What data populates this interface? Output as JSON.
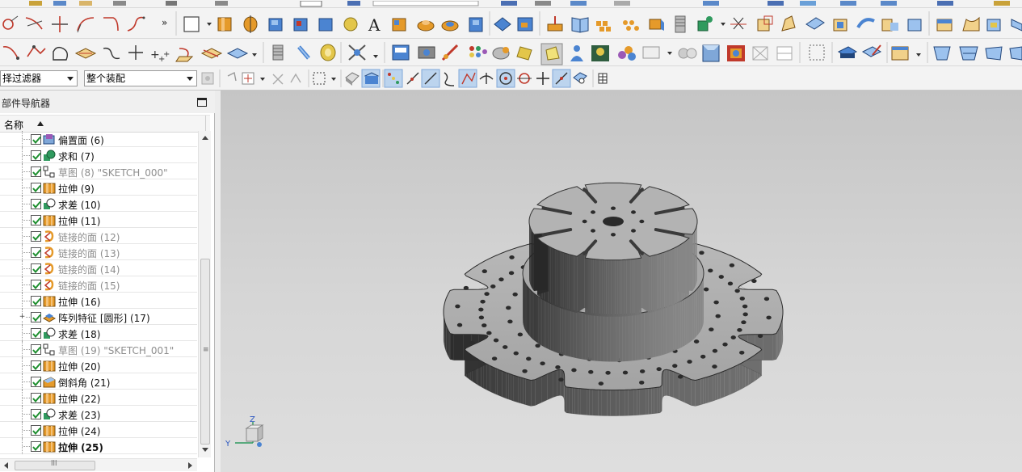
{
  "selection_bar": {
    "filter": "择过滤器",
    "scope": "整个装配"
  },
  "navigator": {
    "title": "部件导航器",
    "column_name": "名称",
    "items": [
      {
        "label": "偏置面 (6)",
        "icon": "offset-face-icon",
        "dim": false,
        "bold": false,
        "expand": false
      },
      {
        "label": "求和 (7)",
        "icon": "unite-icon",
        "dim": false,
        "bold": false,
        "expand": false
      },
      {
        "label": "草图 (8) \"SKETCH_000\"",
        "icon": "sketch-icon",
        "dim": true,
        "bold": false,
        "expand": false
      },
      {
        "label": "拉伸 (9)",
        "icon": "extrude-icon",
        "dim": false,
        "bold": false,
        "expand": false
      },
      {
        "label": "求差 (10)",
        "icon": "subtract-icon",
        "dim": false,
        "bold": false,
        "expand": false
      },
      {
        "label": "拉伸 (11)",
        "icon": "extrude-icon",
        "dim": false,
        "bold": false,
        "expand": false
      },
      {
        "label": "链接的面 (12)",
        "icon": "linked-face-icon",
        "dim": true,
        "bold": false,
        "expand": false
      },
      {
        "label": "链接的面 (13)",
        "icon": "linked-face-icon",
        "dim": true,
        "bold": false,
        "expand": false
      },
      {
        "label": "链接的面 (14)",
        "icon": "linked-face-icon",
        "dim": true,
        "bold": false,
        "expand": false
      },
      {
        "label": "链接的面 (15)",
        "icon": "linked-face-icon",
        "dim": true,
        "bold": false,
        "expand": false
      },
      {
        "label": "拉伸 (16)",
        "icon": "extrude-icon",
        "dim": false,
        "bold": false,
        "expand": false
      },
      {
        "label": "阵列特征 [圆形] (17)",
        "icon": "pattern-feature-icon",
        "dim": false,
        "bold": false,
        "expand": true
      },
      {
        "label": "求差 (18)",
        "icon": "subtract-icon",
        "dim": false,
        "bold": false,
        "expand": false
      },
      {
        "label": "草图 (19) \"SKETCH_001\"",
        "icon": "sketch-icon",
        "dim": true,
        "bold": false,
        "expand": false
      },
      {
        "label": "拉伸 (20)",
        "icon": "extrude-icon",
        "dim": false,
        "bold": false,
        "expand": false
      },
      {
        "label": "倒斜角 (21)",
        "icon": "chamfer-icon",
        "dim": false,
        "bold": false,
        "expand": false
      },
      {
        "label": "拉伸 (22)",
        "icon": "extrude-icon",
        "dim": false,
        "bold": false,
        "expand": false
      },
      {
        "label": "求差 (23)",
        "icon": "subtract-icon",
        "dim": false,
        "bold": false,
        "expand": false
      },
      {
        "label": "拉伸 (24)",
        "icon": "extrude-icon",
        "dim": false,
        "bold": false,
        "expand": false
      },
      {
        "label": "拉伸 (25)",
        "icon": "extrude-icon",
        "dim": false,
        "bold": true,
        "expand": false
      }
    ]
  },
  "triad": {
    "z": "Z",
    "y": "Y"
  },
  "toolbar_row1_icons": [
    "circle-arc-icon",
    "trim-curve-icon",
    "extend-curve-icon",
    "fillet-curve-icon",
    "corner-icon",
    "spline-icon",
    "more-icon",
    "rectangle-icon",
    "extrude-icon",
    "revolve-icon",
    "block-icon",
    "cylinder-icon",
    "cone-icon",
    "sphere-icon",
    "text-icon",
    "hole-icon",
    "boss-icon",
    "pocket-icon",
    "pad-icon",
    "emboss-icon",
    "offset-icon",
    "thicken-icon",
    "book-icon",
    "pattern-icon",
    "mirror-icon",
    "spring-icon",
    "boolean-icon",
    "split-icon",
    "box-icon",
    "sweep-icon",
    "shell-icon",
    "blend-icon",
    "swept-surface-icon",
    "draft-icon",
    "face-icon",
    "sew-icon",
    "fill-icon",
    "patch-icon"
  ],
  "toolbar_row2_icons": [
    "arc-icon",
    "polyline-icon",
    "closed-curve-icon",
    "plane-icon",
    "dimension-icon",
    "point-icon",
    "point-set-icon",
    "project-curve-icon",
    "intersect-icon",
    "offset-curve-icon",
    "thread-icon",
    "spring-coil-icon",
    "tape-icon",
    "tools-icon",
    "movie-icon",
    "camera-icon",
    "brush-icon",
    "palette-icon",
    "render-icon",
    "light-icon",
    "material-icon",
    "person-icon",
    "studio-icon",
    "spheres-icon",
    "display-icon",
    "shaded-icon",
    "cube-icon",
    "texture-icon",
    "wireframe-icon",
    "hidden-icon",
    "section-icon",
    "box-fill-icon",
    "edit-icon",
    "view-icon",
    "surface-icon",
    "surface2-icon",
    "surface3-icon",
    "surface4-icon"
  ],
  "toolbar_row3_icons": [
    "select-all-icon",
    "snap-icon",
    "lasso-icon",
    "move-icon",
    "box-select-icon",
    "shaded-face-icon",
    "solid-body-icon",
    "endpoint-icon",
    "line-snap-icon",
    "line-snap2-icon",
    "curve-icon",
    "midpoint-icon",
    "perpendicular-icon",
    "center-icon",
    "circle-icon",
    "intersection-icon",
    "tangent-icon",
    "measure-icon",
    "grid-icon"
  ]
}
